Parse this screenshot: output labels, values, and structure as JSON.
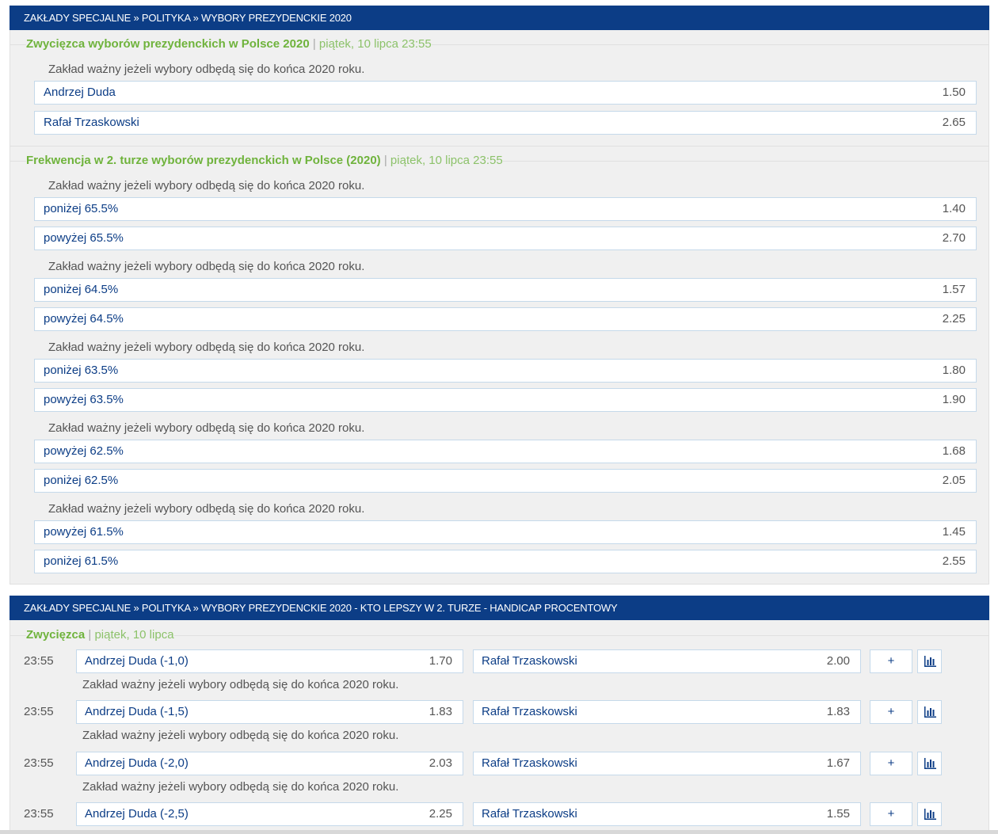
{
  "section1": {
    "breadcrumb": "ZAKŁADY SPECJALNE » POLITYKA » WYBORY PREZYDENCKIE 2020"
  },
  "market1": {
    "title": "Zwycięzca wyborów prezydenckich w Polsce 2020",
    "separator": "|",
    "date": "piątek, 10 lipca 23:55",
    "note": "Zakład ważny jeżeli wybory odbędą się do końca 2020 roku.",
    "outcomes": [
      {
        "label": "Andrzej Duda",
        "odds": "1.50"
      },
      {
        "label": "Rafał Trzaskowski",
        "odds": "2.65"
      }
    ]
  },
  "market2": {
    "title": "Frekwencja w 2. turze wyborów prezydenckich w Polsce (2020)",
    "separator": "|",
    "date": "piątek, 10 lipca 23:55",
    "groups": [
      {
        "note": "Zakład ważny jeżeli wybory odbędą się do końca 2020 roku.",
        "outcomes": [
          {
            "label": "poniżej 65.5%",
            "odds": "1.40"
          },
          {
            "label": "powyżej 65.5%",
            "odds": "2.70"
          }
        ]
      },
      {
        "note": "Zakład ważny jeżeli wybory odbędą się do końca 2020 roku.",
        "outcomes": [
          {
            "label": "poniżej 64.5%",
            "odds": "1.57"
          },
          {
            "label": "powyżej 64.5%",
            "odds": "2.25"
          }
        ]
      },
      {
        "note": "Zakład ważny jeżeli wybory odbędą się do końca 2020 roku.",
        "outcomes": [
          {
            "label": "poniżej 63.5%",
            "odds": "1.80"
          },
          {
            "label": "powyżej 63.5%",
            "odds": "1.90"
          }
        ]
      },
      {
        "note": "Zakład ważny jeżeli wybory odbędą się do końca 2020 roku.",
        "outcomes": [
          {
            "label": "powyżej 62.5%",
            "odds": "1.68"
          },
          {
            "label": "poniżej 62.5%",
            "odds": "2.05"
          }
        ]
      },
      {
        "note": "Zakład ważny jeżeli wybory odbędą się do końca 2020 roku.",
        "outcomes": [
          {
            "label": "powyżej 61.5%",
            "odds": "1.45"
          },
          {
            "label": "poniżej 61.5%",
            "odds": "2.55"
          }
        ]
      }
    ]
  },
  "section2": {
    "breadcrumb": "ZAKŁADY SPECJALNE » POLITYKA » WYBORY PREZYDENCKIE 2020 - KTO LEPSZY W 2. TURZE - HANDICAP PROCENTOWY"
  },
  "market3": {
    "title": "Zwycięzca",
    "separator": "|",
    "date": "piątek, 10 lipca",
    "plus_label": "+",
    "stats_icon": "bar-chart-icon",
    "rows": [
      {
        "time": "23:55",
        "home": "Andrzej Duda (-1,0)",
        "home_odds": "1.70",
        "away": "Rafał Trzaskowski",
        "away_odds": "2.00",
        "note": "Zakład ważny jeżeli wybory odbędą się do końca 2020 roku."
      },
      {
        "time": "23:55",
        "home": "Andrzej Duda (-1,5)",
        "home_odds": "1.83",
        "away": "Rafał Trzaskowski",
        "away_odds": "1.83",
        "note": "Zakład ważny jeżeli wybory odbędą się do końca 2020 roku."
      },
      {
        "time": "23:55",
        "home": "Andrzej Duda (-2,0)",
        "home_odds": "2.03",
        "away": "Rafał Trzaskowski",
        "away_odds": "1.67",
        "note": "Zakład ważny jeżeli wybory odbędą się do końca 2020 roku."
      },
      {
        "time": "23:55",
        "home": "Andrzej Duda (-2,5)",
        "home_odds": "2.25",
        "away": "Rafał Trzaskowski",
        "away_odds": "1.55",
        "note": ""
      }
    ]
  },
  "colors": {
    "header_bg": "#0c3d86",
    "title_green": "#6fb33c",
    "link_blue": "#0c3d86",
    "panel_bg": "#f0f0f0",
    "border": "#c5d9ea"
  }
}
